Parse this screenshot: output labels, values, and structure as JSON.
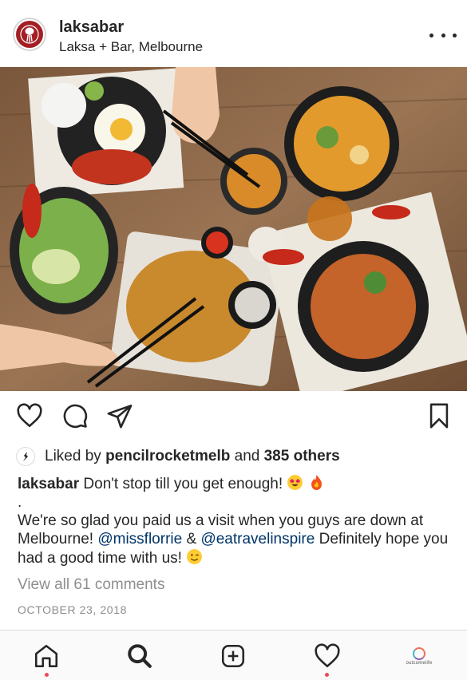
{
  "post": {
    "username": "laksabar",
    "location": "Laksa + Bar, Melbourne",
    "photo_description": "",
    "likes": {
      "prefix": "Liked by",
      "liker": "pencilrocketmelb",
      "joiner": "and",
      "others": "385 others"
    },
    "caption": {
      "author": "laksabar",
      "line1": "Don't stop till you get enough!",
      "dot": ".",
      "body_start": "We're so glad you paid us a visit when you guys are down at Melbourne!",
      "mention1": "@missflorrie",
      "amp": "&",
      "mention2": "@eatravelinspire",
      "body_end": "Definitely hope you had a good time with us!"
    },
    "view_comments": "View all 61 comments",
    "date": "OCTOBER 23, 2018"
  },
  "icons": {
    "more": "more-options-icon",
    "like": "heart-icon",
    "comment": "comment-icon",
    "share": "paper-plane-icon",
    "save": "bookmark-icon",
    "nav": [
      "home-icon",
      "search-icon",
      "add-post-icon",
      "activity-heart-icon",
      "profile-icon"
    ]
  },
  "bottom_nav": {
    "profile_label": "outcomelife"
  },
  "colors": {
    "mention": "#003569",
    "secondary_text": "#8e8e8e",
    "notification_dot": "#ed4956",
    "brand_red": "#a31f24"
  }
}
